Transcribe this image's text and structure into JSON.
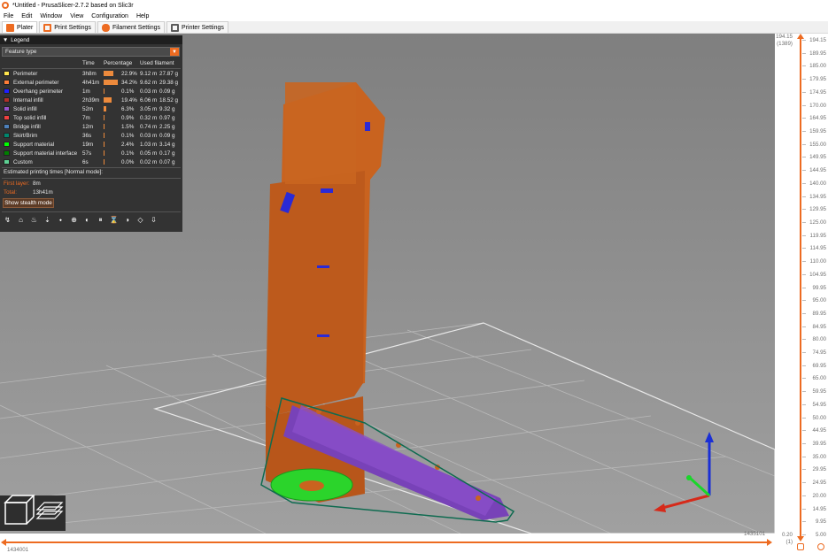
{
  "window": {
    "title": "*Untitled - PrusaSlicer-2.7.2 based on Slic3r"
  },
  "menu": [
    "File",
    "Edit",
    "Window",
    "View",
    "Configuration",
    "Help"
  ],
  "tabs": [
    {
      "label": "Plater",
      "icon": "plater-icon",
      "color": "#ed6b21"
    },
    {
      "label": "Print Settings",
      "icon": "print-settings-icon",
      "color": "#ed6b21"
    },
    {
      "label": "Filament Settings",
      "icon": "filament-icon",
      "color": "#ed6b21"
    },
    {
      "label": "Printer Settings",
      "icon": "printer-icon",
      "color": "#5a5a5a"
    }
  ],
  "legend": {
    "title": "Legend",
    "view_type": "Feature type",
    "columns": {
      "time": "Time",
      "percentage": "Percentage",
      "filament": "Used filament"
    },
    "rows": [
      {
        "name": "Perimeter",
        "color": "#ffe64d",
        "time": "3h8m",
        "pct": "22.9%",
        "pct_value": 22.9,
        "len": "9.12 m",
        "weight": "27.87 g"
      },
      {
        "name": "External perimeter",
        "color": "#ff7d38",
        "time": "4h41m",
        "pct": "34.2%",
        "pct_value": 34.2,
        "len": "9.62 m",
        "weight": "29.38 g"
      },
      {
        "name": "Overhang perimeter",
        "color": "#1f1fff",
        "time": "1m",
        "pct": "0.1%",
        "pct_value": 0.1,
        "len": "0.03 m",
        "weight": "0.09 g"
      },
      {
        "name": "Internal infill",
        "color": "#b03029",
        "time": "2h39m",
        "pct": "19.4%",
        "pct_value": 19.4,
        "len": "6.06 m",
        "weight": "18.52 g"
      },
      {
        "name": "Solid infill",
        "color": "#9654cc",
        "time": "52m",
        "pct": "6.3%",
        "pct_value": 6.3,
        "len": "3.05 m",
        "weight": "9.32 g"
      },
      {
        "name": "Top solid infill",
        "color": "#f04040",
        "time": "7m",
        "pct": "0.9%",
        "pct_value": 0.9,
        "len": "0.32 m",
        "weight": "0.97 g"
      },
      {
        "name": "Bridge infill",
        "color": "#4d80ba",
        "time": "12m",
        "pct": "1.5%",
        "pct_value": 1.5,
        "len": "0.74 m",
        "weight": "2.25 g"
      },
      {
        "name": "Skirt/Brim",
        "color": "#00876e",
        "time": "36s",
        "pct": "0.1%",
        "pct_value": 0.1,
        "len": "0.03 m",
        "weight": "0.09 g"
      },
      {
        "name": "Support material",
        "color": "#00ff00",
        "time": "19m",
        "pct": "2.4%",
        "pct_value": 2.4,
        "len": "1.03 m",
        "weight": "3.14 g"
      },
      {
        "name": "Support material interface",
        "color": "#008000",
        "time": "57s",
        "pct": "0.1%",
        "pct_value": 0.1,
        "len": "0.05 m",
        "weight": "0.17 g"
      },
      {
        "name": "Custom",
        "color": "#5ed194",
        "time": "6s",
        "pct": "0.0%",
        "pct_value": 0.0,
        "len": "0.02 m",
        "weight": "0.07 g"
      }
    ],
    "estimated_label": "Estimated printing times [Normal mode]:",
    "first_layer_label": "First layer:",
    "first_layer_value": "8m",
    "total_label": "Total:",
    "total_value": "13h41m",
    "stealth_button": "Show stealth mode"
  },
  "vertical_slider": {
    "top_value": "194.15",
    "top_layer": "(1389)",
    "bottom_value": "0.20",
    "bottom_layer": "(1)",
    "ticks": [
      "194.15",
      "189.95",
      "185.00",
      "179.95",
      "174.95",
      "170.00",
      "164.95",
      "159.95",
      "155.00",
      "149.95",
      "144.95",
      "140.00",
      "134.95",
      "129.95",
      "125.00",
      "119.95",
      "114.95",
      "110.00",
      "104.95",
      "99.95",
      "95.00",
      "89.95",
      "84.95",
      "80.00",
      "74.95",
      "69.95",
      "65.00",
      "59.95",
      "54.95",
      "50.00",
      "44.95",
      "39.95",
      "35.00",
      "29.95",
      "24.95",
      "20.00",
      "14.95",
      "9.95",
      "5.00"
    ]
  },
  "horizontal_slider": {
    "right_value": "1435101",
    "left_value": "1434001"
  }
}
